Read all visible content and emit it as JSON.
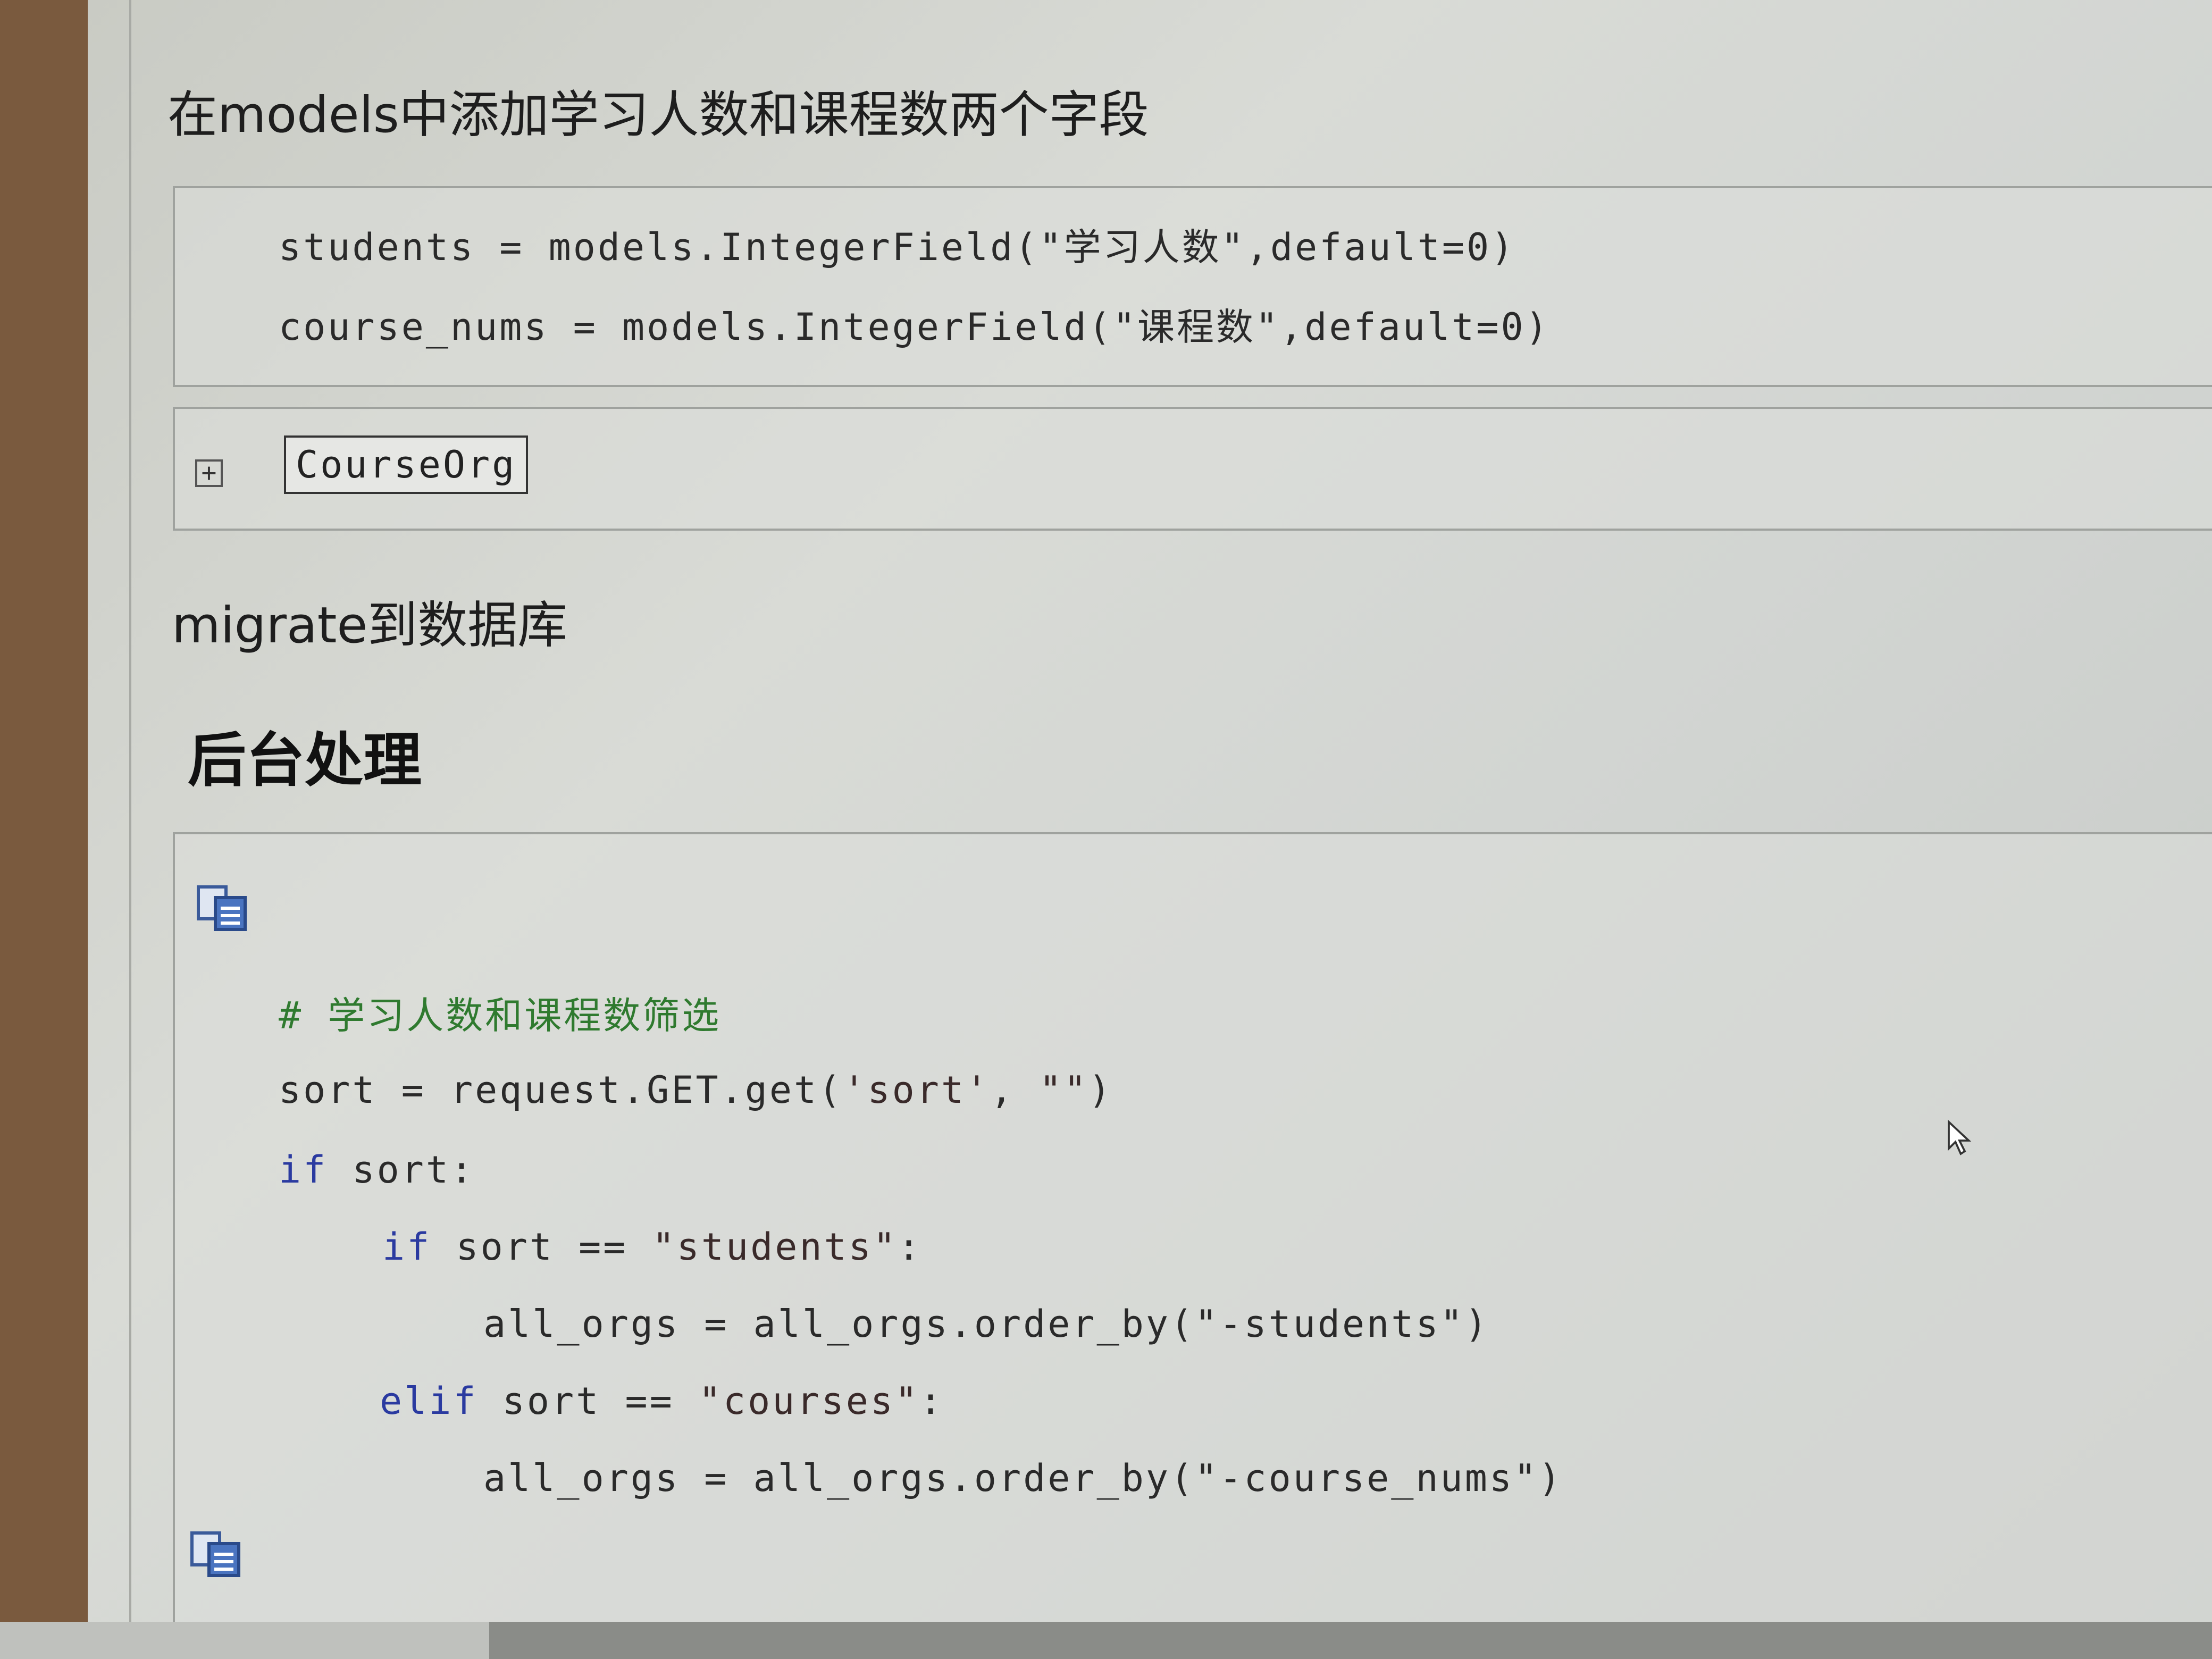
{
  "article": {
    "intro_heading": "在models中添加学习人数和课程数两个字段",
    "migrate_heading": "migrate到数据库",
    "backend_heading": "后台处理"
  },
  "model_code": {
    "line1": "students = models.IntegerField(\"学习人数\",default=0)",
    "line2": "course_nums = models.IntegerField(\"课程数\",default=0)"
  },
  "collapsed_block": {
    "expand_symbol": "+",
    "class_name": "CourseOrg"
  },
  "view_code": {
    "comment": "# 学习人数和课程数筛选",
    "line1_a": "sort = request.GET.get(",
    "line1_b": "'sort'",
    "line1_c": ", ",
    "line1_d": "\"\"",
    "line1_e": ")",
    "kw_if": "if",
    "line2_rest": " sort:",
    "kw_if_inner": "if",
    "line3_rest": " sort == ",
    "line3_str": "\"students\"",
    "line3_end": ":",
    "line4": "all_orgs = all_orgs.order_by(\"-students\")",
    "kw_elif": "elif",
    "line5_rest": " sort == ",
    "line5_str": "\"courses\"",
    "line5_end": ":",
    "line6": "all_orgs = all_orgs.order_by(\"-course_nums\")"
  },
  "icons": {
    "copy": "copy-code-icon",
    "expand": "expand-icon",
    "cursor": "mouse-cursor-icon"
  },
  "colors": {
    "keyword": "#2a3aa0",
    "comment": "#2f7a2f"
  }
}
